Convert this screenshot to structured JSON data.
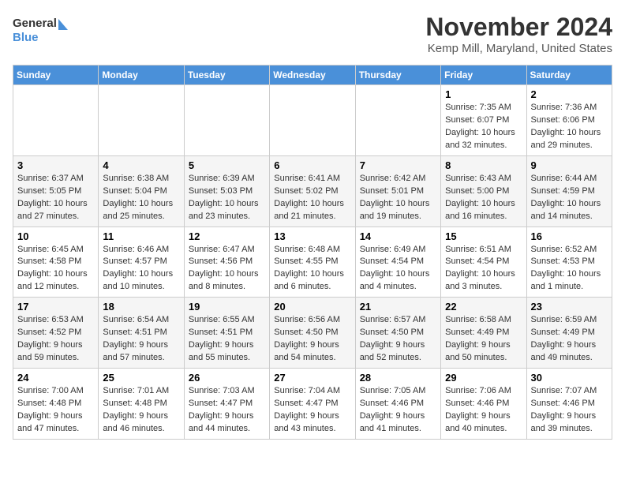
{
  "header": {
    "logo_line1": "General",
    "logo_line2": "Blue",
    "month": "November 2024",
    "location": "Kemp Mill, Maryland, United States"
  },
  "weekdays": [
    "Sunday",
    "Monday",
    "Tuesday",
    "Wednesday",
    "Thursday",
    "Friday",
    "Saturday"
  ],
  "weeks": [
    [
      {
        "day": "",
        "info": ""
      },
      {
        "day": "",
        "info": ""
      },
      {
        "day": "",
        "info": ""
      },
      {
        "day": "",
        "info": ""
      },
      {
        "day": "",
        "info": ""
      },
      {
        "day": "1",
        "info": "Sunrise: 7:35 AM\nSunset: 6:07 PM\nDaylight: 10 hours and 32 minutes."
      },
      {
        "day": "2",
        "info": "Sunrise: 7:36 AM\nSunset: 6:06 PM\nDaylight: 10 hours and 29 minutes."
      }
    ],
    [
      {
        "day": "3",
        "info": "Sunrise: 6:37 AM\nSunset: 5:05 PM\nDaylight: 10 hours and 27 minutes."
      },
      {
        "day": "4",
        "info": "Sunrise: 6:38 AM\nSunset: 5:04 PM\nDaylight: 10 hours and 25 minutes."
      },
      {
        "day": "5",
        "info": "Sunrise: 6:39 AM\nSunset: 5:03 PM\nDaylight: 10 hours and 23 minutes."
      },
      {
        "day": "6",
        "info": "Sunrise: 6:41 AM\nSunset: 5:02 PM\nDaylight: 10 hours and 21 minutes."
      },
      {
        "day": "7",
        "info": "Sunrise: 6:42 AM\nSunset: 5:01 PM\nDaylight: 10 hours and 19 minutes."
      },
      {
        "day": "8",
        "info": "Sunrise: 6:43 AM\nSunset: 5:00 PM\nDaylight: 10 hours and 16 minutes."
      },
      {
        "day": "9",
        "info": "Sunrise: 6:44 AM\nSunset: 4:59 PM\nDaylight: 10 hours and 14 minutes."
      }
    ],
    [
      {
        "day": "10",
        "info": "Sunrise: 6:45 AM\nSunset: 4:58 PM\nDaylight: 10 hours and 12 minutes."
      },
      {
        "day": "11",
        "info": "Sunrise: 6:46 AM\nSunset: 4:57 PM\nDaylight: 10 hours and 10 minutes."
      },
      {
        "day": "12",
        "info": "Sunrise: 6:47 AM\nSunset: 4:56 PM\nDaylight: 10 hours and 8 minutes."
      },
      {
        "day": "13",
        "info": "Sunrise: 6:48 AM\nSunset: 4:55 PM\nDaylight: 10 hours and 6 minutes."
      },
      {
        "day": "14",
        "info": "Sunrise: 6:49 AM\nSunset: 4:54 PM\nDaylight: 10 hours and 4 minutes."
      },
      {
        "day": "15",
        "info": "Sunrise: 6:51 AM\nSunset: 4:54 PM\nDaylight: 10 hours and 3 minutes."
      },
      {
        "day": "16",
        "info": "Sunrise: 6:52 AM\nSunset: 4:53 PM\nDaylight: 10 hours and 1 minute."
      }
    ],
    [
      {
        "day": "17",
        "info": "Sunrise: 6:53 AM\nSunset: 4:52 PM\nDaylight: 9 hours and 59 minutes."
      },
      {
        "day": "18",
        "info": "Sunrise: 6:54 AM\nSunset: 4:51 PM\nDaylight: 9 hours and 57 minutes."
      },
      {
        "day": "19",
        "info": "Sunrise: 6:55 AM\nSunset: 4:51 PM\nDaylight: 9 hours and 55 minutes."
      },
      {
        "day": "20",
        "info": "Sunrise: 6:56 AM\nSunset: 4:50 PM\nDaylight: 9 hours and 54 minutes."
      },
      {
        "day": "21",
        "info": "Sunrise: 6:57 AM\nSunset: 4:50 PM\nDaylight: 9 hours and 52 minutes."
      },
      {
        "day": "22",
        "info": "Sunrise: 6:58 AM\nSunset: 4:49 PM\nDaylight: 9 hours and 50 minutes."
      },
      {
        "day": "23",
        "info": "Sunrise: 6:59 AM\nSunset: 4:49 PM\nDaylight: 9 hours and 49 minutes."
      }
    ],
    [
      {
        "day": "24",
        "info": "Sunrise: 7:00 AM\nSunset: 4:48 PM\nDaylight: 9 hours and 47 minutes."
      },
      {
        "day": "25",
        "info": "Sunrise: 7:01 AM\nSunset: 4:48 PM\nDaylight: 9 hours and 46 minutes."
      },
      {
        "day": "26",
        "info": "Sunrise: 7:03 AM\nSunset: 4:47 PM\nDaylight: 9 hours and 44 minutes."
      },
      {
        "day": "27",
        "info": "Sunrise: 7:04 AM\nSunset: 4:47 PM\nDaylight: 9 hours and 43 minutes."
      },
      {
        "day": "28",
        "info": "Sunrise: 7:05 AM\nSunset: 4:46 PM\nDaylight: 9 hours and 41 minutes."
      },
      {
        "day": "29",
        "info": "Sunrise: 7:06 AM\nSunset: 4:46 PM\nDaylight: 9 hours and 40 minutes."
      },
      {
        "day": "30",
        "info": "Sunrise: 7:07 AM\nSunset: 4:46 PM\nDaylight: 9 hours and 39 minutes."
      }
    ]
  ]
}
